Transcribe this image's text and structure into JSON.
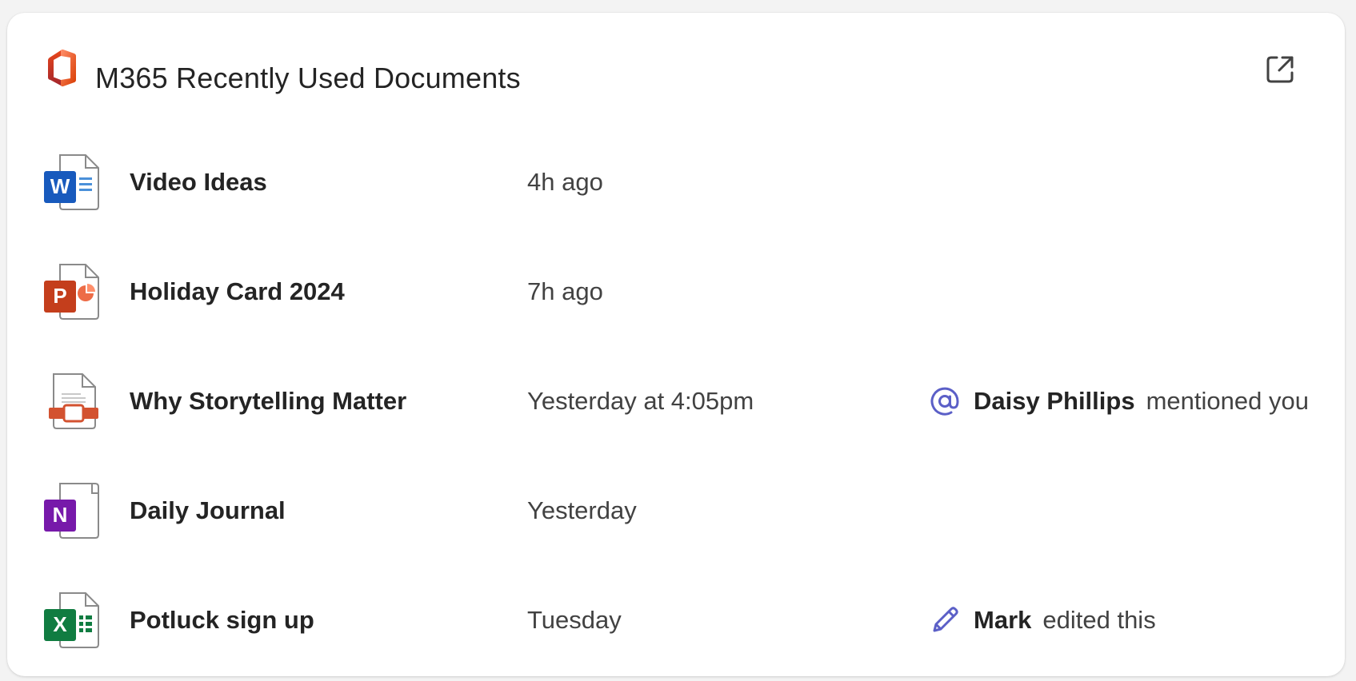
{
  "header": {
    "title": "M365 Recently Used Documents",
    "logo_icon": "microsoft-365-logo",
    "open_icon": "open-in-new-icon"
  },
  "colors": {
    "word": "#185abd",
    "powerpoint": "#c43e1c",
    "pdf": "#d35230",
    "onenote": "#7719aa",
    "excel": "#107c41",
    "activity_accent": "#5b5fc7"
  },
  "documents": [
    {
      "name": "Video Ideas",
      "time": "4h ago",
      "app": "word",
      "icon_letter": "W",
      "activity": null
    },
    {
      "name": "Holiday Card 2024",
      "time": "7h ago",
      "app": "powerpoint",
      "icon_letter": "P",
      "activity": null
    },
    {
      "name": "Why Storytelling Matter",
      "time": "Yesterday at 4:05pm",
      "app": "pdf",
      "icon_letter": "",
      "activity": {
        "icon": "mention-icon",
        "person": "Daisy Phillips",
        "action": "mentioned you"
      }
    },
    {
      "name": "Daily Journal",
      "time": "Yesterday",
      "app": "onenote",
      "icon_letter": "N",
      "activity": null
    },
    {
      "name": "Potluck sign up",
      "time": "Tuesday",
      "app": "excel",
      "icon_letter": "X",
      "activity": {
        "icon": "pencil-icon",
        "person": "Mark",
        "action": "edited this"
      }
    }
  ]
}
